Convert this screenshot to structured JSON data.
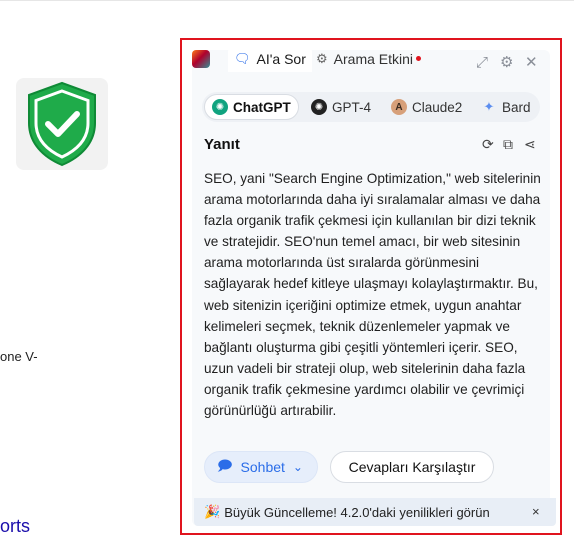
{
  "background_page": {
    "left_fragment_text": "one V-",
    "left_link_text": "orts",
    "shield_tile": {
      "shield_color": "#1fab4a",
      "icon": "shield-check-icon"
    }
  },
  "panel": {
    "border_color": "#e0141e",
    "tabs": [
      {
        "label": "AI'a Sor",
        "icon": "chat-icon",
        "active": true
      },
      {
        "label": "Arama Etkini",
        "icon": "gear-icon",
        "active": false,
        "has_dot": true
      }
    ],
    "tool_icons": [
      "expand-icon",
      "settings-icon",
      "close-icon"
    ],
    "models": [
      {
        "label": "ChatGPT",
        "selected": true,
        "icon_color": "#10a37f"
      },
      {
        "label": "GPT-4",
        "selected": false,
        "icon_color": "#222222"
      },
      {
        "label": "Claude2",
        "selected": false,
        "icon_color": "#d7a07a"
      },
      {
        "label": "Bard",
        "selected": false,
        "icon_color": "#5b8def"
      }
    ],
    "answer": {
      "title": "Yanıt",
      "icons": [
        "refresh-icon",
        "copy-icon",
        "share-icon"
      ],
      "text": "SEO, yani \"Search Engine Optimization,\" web sitelerinin arama motorlarında daha iyi sıralamalar alması ve daha fazla organik trafik çekmesi için kullanılan bir dizi teknik ve stratejidir. SEO'nun temel amacı, bir web sitesinin arama motorlarında üst sıralarda görünmesini sağlayarak hedef kitleye ulaşmayı kolaylaştırmaktır. Bu, web sitenizin içeriğini optimize etmek, uygun anahtar kelimeleri seçmek, teknik düzenlemeler yapmak ve bağlantı oluşturma gibi çeşitli yöntemleri içerir. SEO, uzun vadeli bir strateji olup, web sitelerinin daha fazla organik trafik çekmesine yardımcı olabilir ve çevrimiçi görünürlüğü artırabilir."
    },
    "actions": {
      "chat_label": "Sohbet",
      "compare_label": "Cevapları Karşılaştır"
    },
    "update_banner": {
      "emoji": "🎉",
      "text": "Büyük Güncelleme! 4.2.0'daki yenilikleri görün",
      "close": "×"
    }
  }
}
